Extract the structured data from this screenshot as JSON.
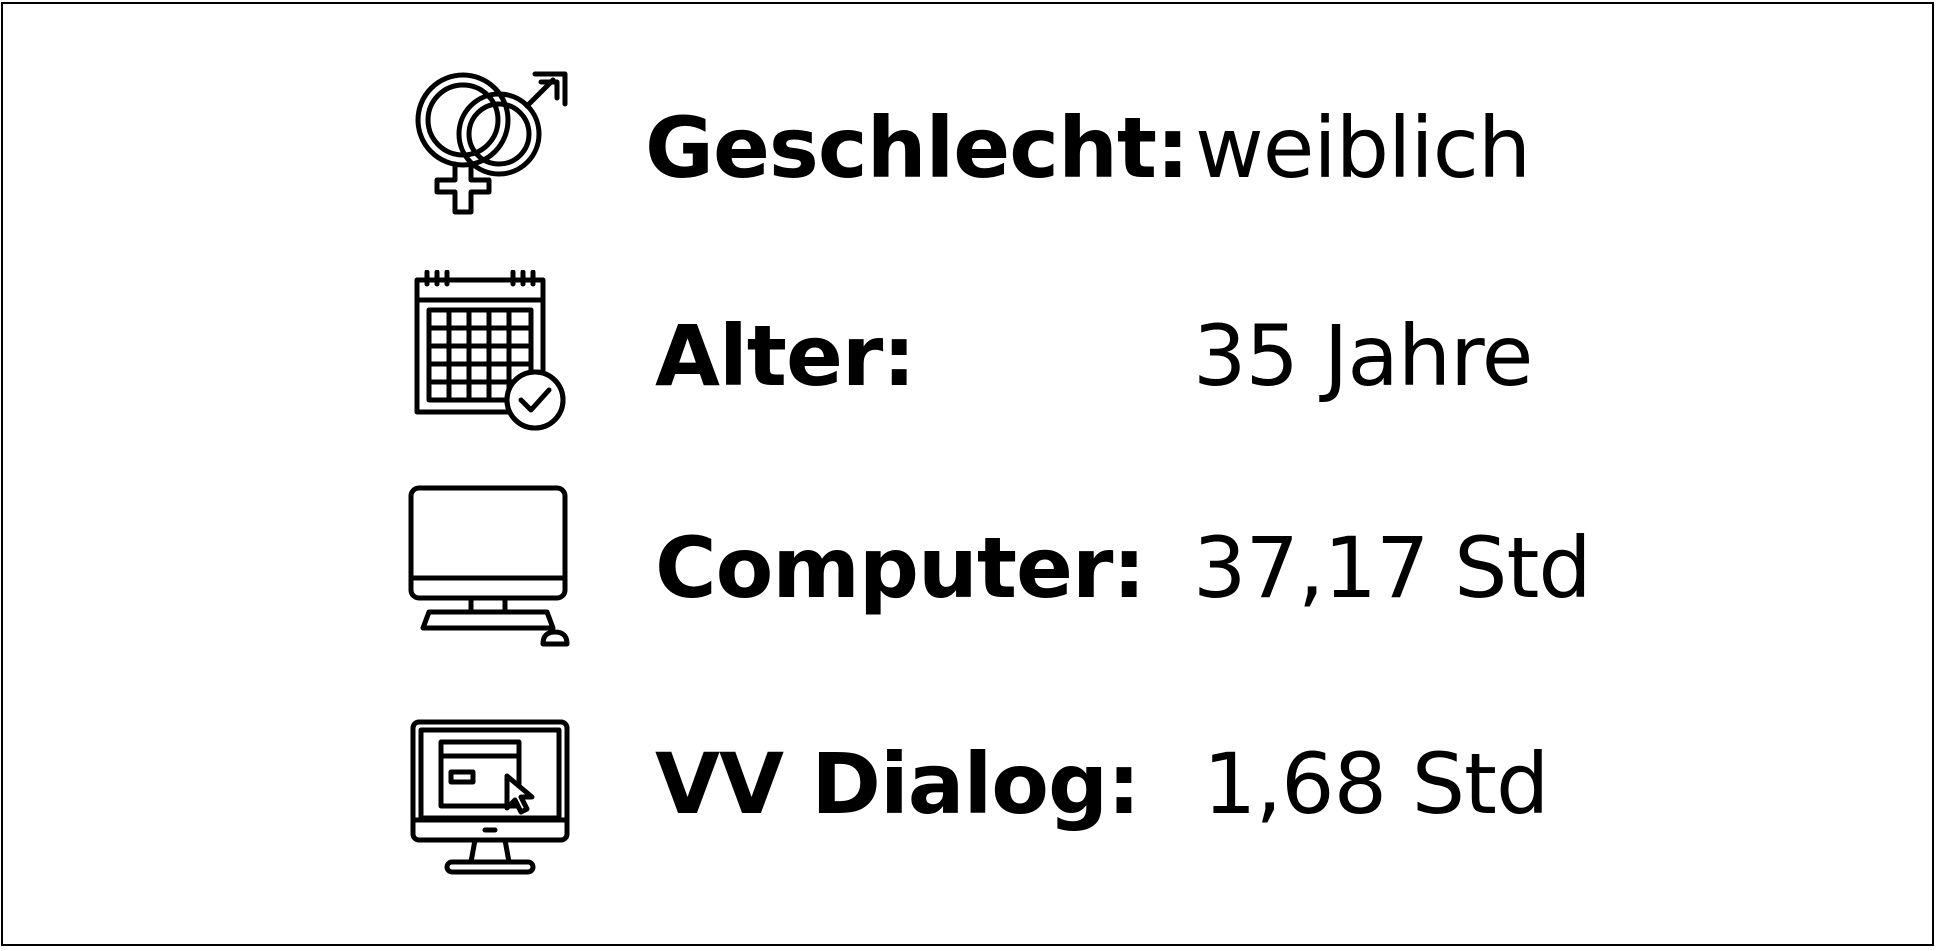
{
  "rows": [
    {
      "icon": "gender-icon",
      "label": "Geschlecht:",
      "value": "weiblich"
    },
    {
      "icon": "calendar-clock-icon",
      "label": "Alter:",
      "value": "35 Jahre"
    },
    {
      "icon": "computer-icon",
      "label": "Computer:",
      "value": "37,17 Std"
    },
    {
      "icon": "monitor-dialog-cursor-icon",
      "label": "VV Dialog:",
      "value": "1,68 Std"
    }
  ]
}
